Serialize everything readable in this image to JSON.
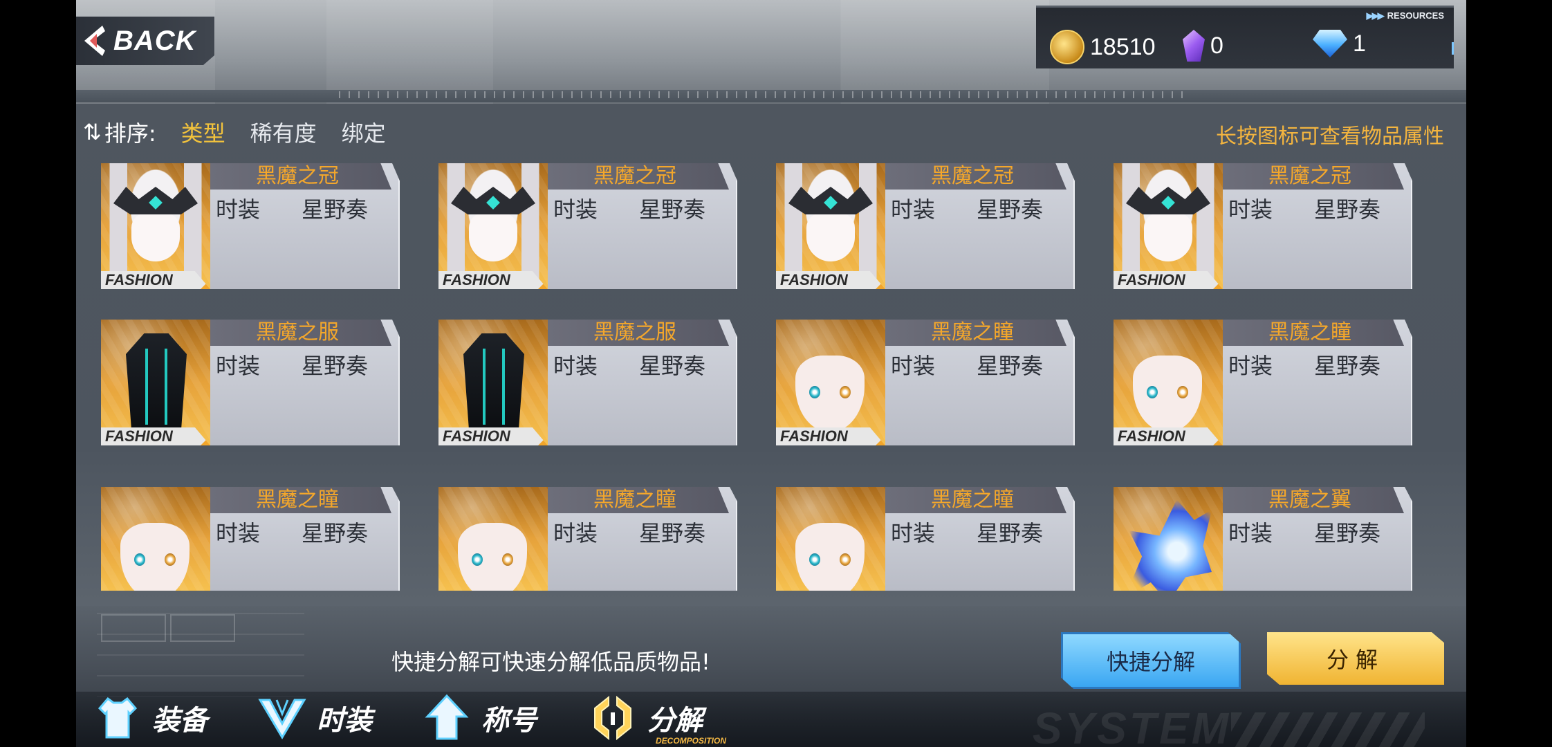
{
  "header": {
    "back_label": "BACK",
    "resources_tag": "RESOURCES",
    "resources": [
      {
        "icon": "gold-coin-icon",
        "value": "18510"
      },
      {
        "icon": "purple-crystal-icon",
        "value": "0"
      },
      {
        "icon": "blue-diamond-icon",
        "value": "1"
      }
    ]
  },
  "sort": {
    "label": "排序:",
    "options": [
      "类型",
      "稀有度",
      "绑定"
    ],
    "active_index": 0
  },
  "hint": "长按图标可查看物品属性",
  "items": [
    {
      "name": "黑魔之冠",
      "type": "时装",
      "owner": "星野奏",
      "tag": "FASHION",
      "icon": "crown-headpiece-icon"
    },
    {
      "name": "黑魔之冠",
      "type": "时装",
      "owner": "星野奏",
      "tag": "FASHION",
      "icon": "crown-headpiece-icon"
    },
    {
      "name": "黑魔之冠",
      "type": "时装",
      "owner": "星野奏",
      "tag": "FASHION",
      "icon": "crown-headpiece-icon"
    },
    {
      "name": "黑魔之冠",
      "type": "时装",
      "owner": "星野奏",
      "tag": "FASHION",
      "icon": "crown-headpiece-icon"
    },
    {
      "name": "黑魔之服",
      "type": "时装",
      "owner": "星野奏",
      "tag": "FASHION",
      "icon": "dark-armor-icon"
    },
    {
      "name": "黑魔之服",
      "type": "时装",
      "owner": "星野奏",
      "tag": "FASHION",
      "icon": "dark-armor-icon"
    },
    {
      "name": "黑魔之瞳",
      "type": "时装",
      "owner": "星野奏",
      "tag": "FASHION",
      "icon": "face-eyes-icon"
    },
    {
      "name": "黑魔之瞳",
      "type": "时装",
      "owner": "星野奏",
      "tag": "FASHION",
      "icon": "face-eyes-icon"
    },
    {
      "name": "黑魔之瞳",
      "type": "时装",
      "owner": "星野奏",
      "tag": "",
      "icon": "face-eyes-icon"
    },
    {
      "name": "黑魔之瞳",
      "type": "时装",
      "owner": "星野奏",
      "tag": "",
      "icon": "face-eyes-icon"
    },
    {
      "name": "黑魔之瞳",
      "type": "时装",
      "owner": "星野奏",
      "tag": "",
      "icon": "face-eyes-icon"
    },
    {
      "name": "黑魔之翼",
      "type": "时装",
      "owner": "星野奏",
      "tag": "",
      "icon": "blue-wing-icon"
    }
  ],
  "footer": {
    "decompose_hint": "快捷分解可快速分解低品质物品!",
    "quick_decompose_label": "快捷分解",
    "decompose_label": "分解",
    "system_watermark": "SYSTEM"
  },
  "nav": [
    {
      "label": "装备",
      "icon": "equipment-shirt-icon"
    },
    {
      "label": "时装",
      "icon": "fashion-v-icon"
    },
    {
      "label": "称号",
      "icon": "title-arrow-icon"
    },
    {
      "label": "分解",
      "icon": "decompose-icon",
      "sub": "DECOMPOSITION",
      "active": true
    }
  ],
  "colors": {
    "accent_gold": "#f4a72b",
    "accent_blue": "#3aa6f2"
  }
}
